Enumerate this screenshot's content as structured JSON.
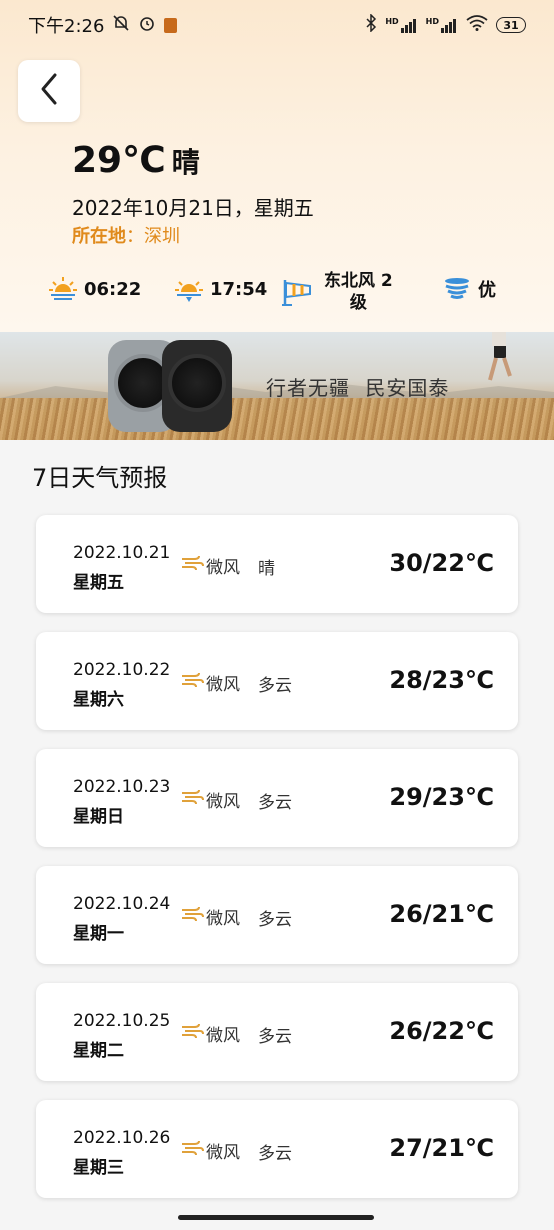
{
  "status_bar": {
    "time": "下午2:26",
    "battery": "31",
    "net1": "HD",
    "net2": "HD"
  },
  "current": {
    "temperature": "29℃",
    "condition": "晴",
    "date": "2022年10月21日，星期五",
    "location_label": "所在地",
    "location_sep": "：",
    "location_value": "深圳"
  },
  "stats": {
    "sunrise": "06:22",
    "sunset": "17:54",
    "wind_line1": "东北风 2",
    "wind_line2": "级",
    "air_quality": "优"
  },
  "banner": {
    "slogan": "行者无疆  民安国泰"
  },
  "forecast": {
    "title": "7日天气预报",
    "days": [
      {
        "date": "2022.10.21",
        "weekday": "星期五",
        "wind": "微风",
        "weather": "晴",
        "range": "30/22℃"
      },
      {
        "date": "2022.10.22",
        "weekday": "星期六",
        "wind": "微风",
        "weather": "多云",
        "range": "28/23℃"
      },
      {
        "date": "2022.10.23",
        "weekday": "星期日",
        "wind": "微风",
        "weather": "多云",
        "range": "29/23℃"
      },
      {
        "date": "2022.10.24",
        "weekday": "星期一",
        "wind": "微风",
        "weather": "多云",
        "range": "26/21℃"
      },
      {
        "date": "2022.10.25",
        "weekday": "星期二",
        "wind": "微风",
        "weather": "多云",
        "range": "26/22℃"
      },
      {
        "date": "2022.10.26",
        "weekday": "星期三",
        "wind": "微风",
        "weather": "多云",
        "range": "27/21℃"
      }
    ]
  },
  "colors": {
    "accent": "#e08a1c",
    "icon_blue": "#3a8fd9",
    "icon_orange": "#f2a11f"
  }
}
